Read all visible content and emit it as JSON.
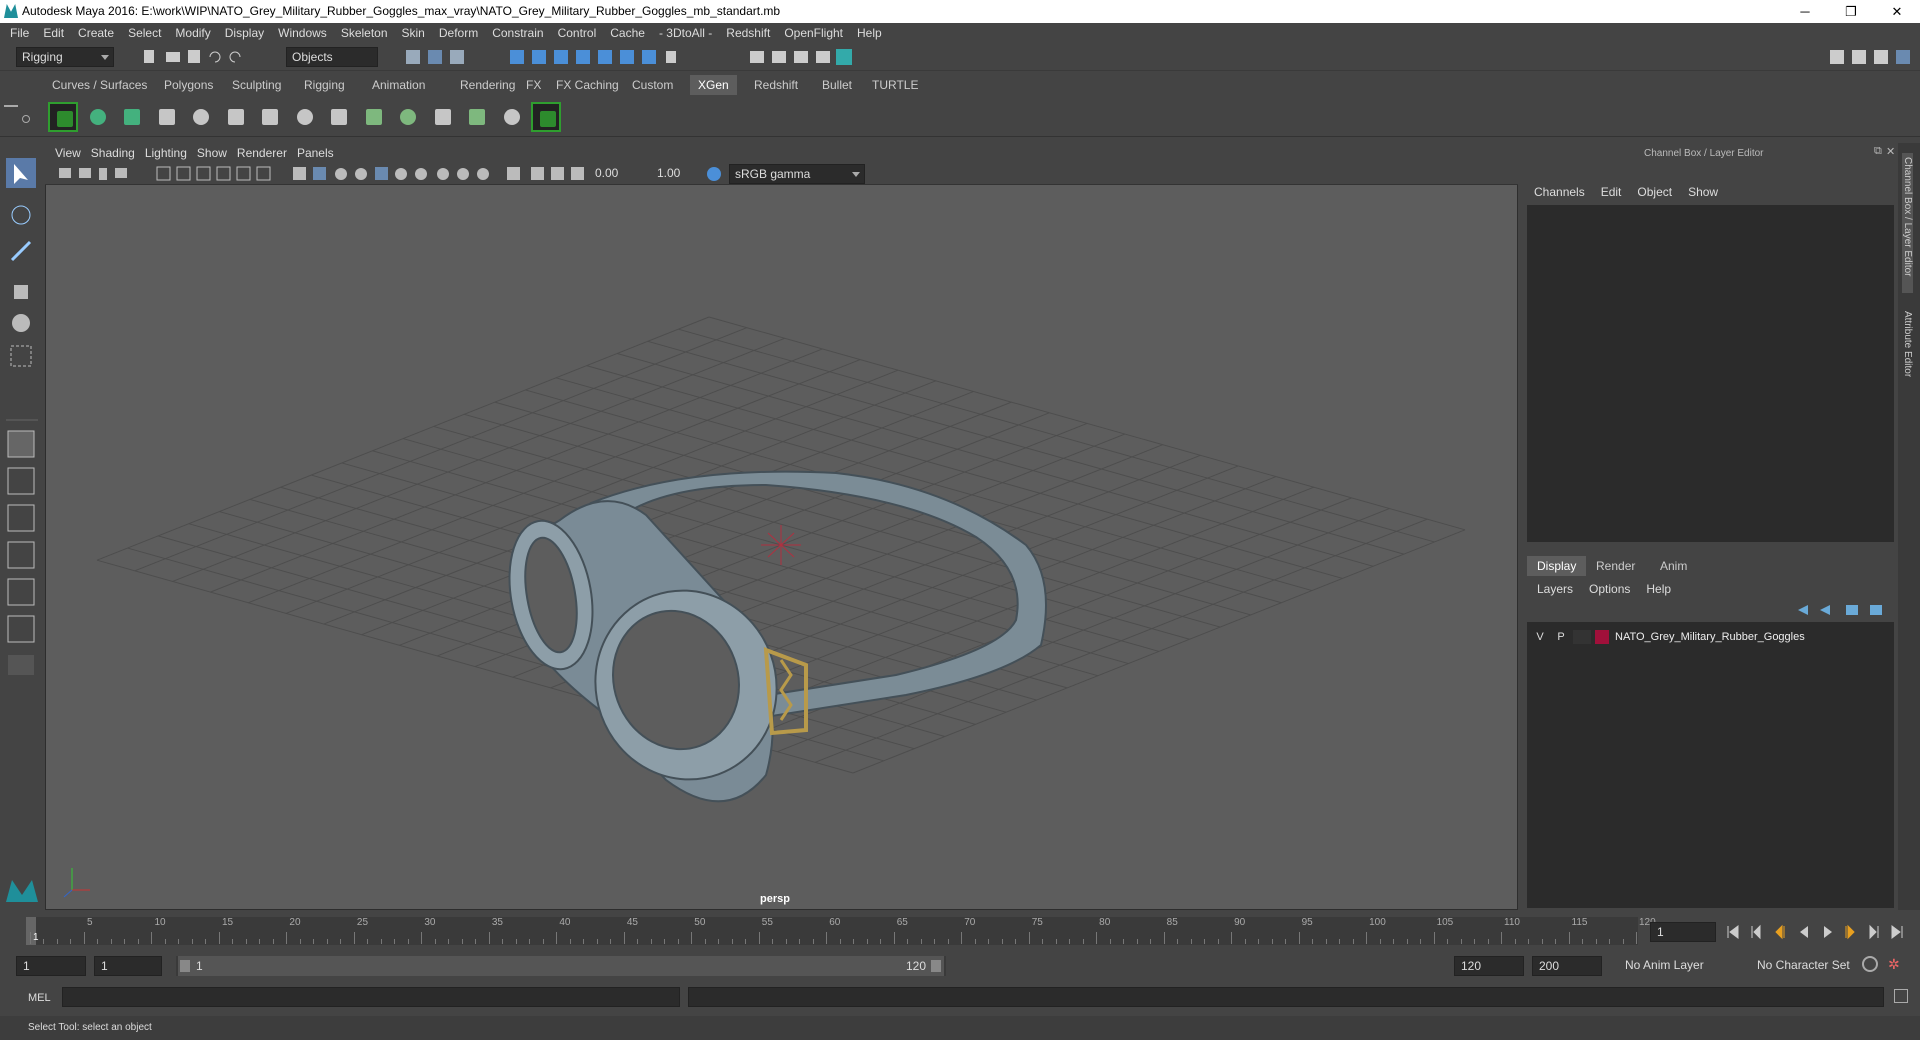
{
  "window": {
    "title": "Autodesk Maya 2016: E:\\work\\WIP\\NATO_Grey_Military_Rubber_Goggles_max_vray\\NATO_Grey_Military_Rubber_Goggles_mb_standart.mb",
    "minimize": "─",
    "maximize": "❐",
    "close": "✕"
  },
  "menu": [
    "File",
    "Edit",
    "Create",
    "Select",
    "Modify",
    "Display",
    "Windows",
    "Skeleton",
    "Skin",
    "Deform",
    "Constrain",
    "Control",
    "Cache",
    "- 3DtoAll -",
    "Redshift",
    "OpenFlight",
    "Help"
  ],
  "status": {
    "mode": "Rigging",
    "selection_mode": "Objects"
  },
  "shelf_tabs": [
    "Curves / Surfaces",
    "Polygons",
    "Sculpting",
    "Rigging",
    "Animation",
    "Rendering",
    "FX",
    "FX Caching",
    "Custom",
    "XGen",
    "Redshift",
    "Bullet",
    "TURTLE"
  ],
  "shelf_active": "XGen",
  "viewport": {
    "menu": [
      "View",
      "Shading",
      "Lighting",
      "Show",
      "Renderer",
      "Panels"
    ],
    "exposure": "0.00",
    "gamma": "1.00",
    "colorspace": "sRGB gamma",
    "camera_label": "persp"
  },
  "channel_box": {
    "header": "Channel Box / Layer Editor",
    "menu": [
      "Channels",
      "Edit",
      "Object",
      "Show"
    ]
  },
  "layer_editor": {
    "tabs": [
      "Display",
      "Render",
      "Anim"
    ],
    "active_tab": "Display",
    "menu": [
      "Layers",
      "Options",
      "Help"
    ],
    "layers": [
      {
        "v": "V",
        "p": "P",
        "name": "NATO_Grey_Military_Rubber_Goggles",
        "color": "#a0103a"
      }
    ]
  },
  "side_tabs": [
    "Channel Box / Layer Editor",
    "Attribute Editor"
  ],
  "timeline": {
    "ticks": [
      "1",
      "5",
      "10",
      "15",
      "20",
      "25",
      "30",
      "35",
      "40",
      "45",
      "50",
      "55",
      "60",
      "65",
      "70",
      "75",
      "80",
      "85",
      "90",
      "95",
      "100",
      "105",
      "110",
      "115",
      "120"
    ],
    "current_frame": "1"
  },
  "range": {
    "start": "1",
    "playback_start": "1",
    "slider_start": "1",
    "slider_end": "120",
    "playback_end": "120",
    "end": "200",
    "anim_layer": "No Anim Layer",
    "character_set": "No Character Set"
  },
  "command": {
    "label": "MEL"
  },
  "help_line": "Select Tool: select an object",
  "colors": {
    "accent": "#1f8f9a",
    "ui_bg": "#444444",
    "viewport_bg": "#5d5d5d",
    "layer_color": "#a0103a"
  }
}
